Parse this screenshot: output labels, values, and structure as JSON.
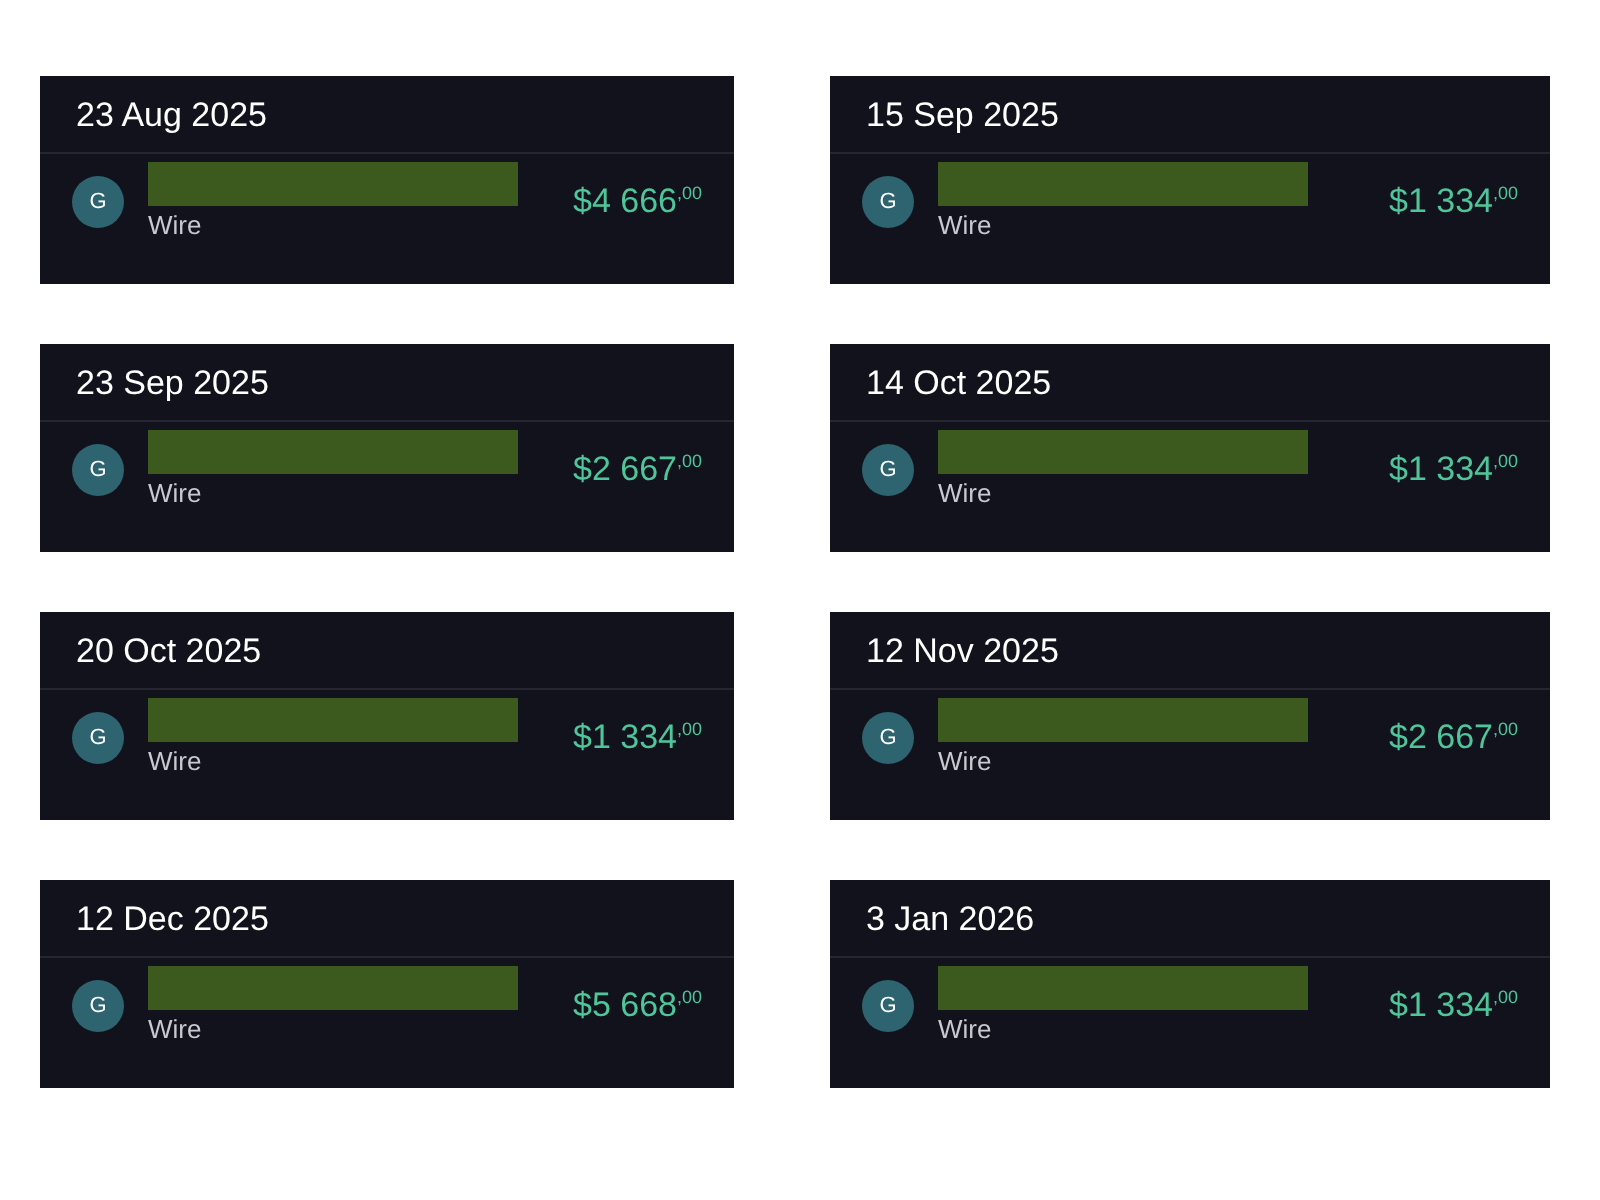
{
  "transactions": [
    {
      "date": "23 Aug 2025",
      "avatar": "G",
      "method": "Wire",
      "amount": "$4 666$^{,00}$"
    },
    {
      "date": "15 Sep 2025",
      "avatar": "G",
      "method": "Wire",
      "amount": "$1 334$^{,00}$"
    },
    {
      "date": "23 Sep 2025",
      "avatar": "G",
      "method": "Wire",
      "amount": "$2 667$^{,00}$"
    },
    {
      "date": "14 Oct 2025",
      "avatar": "G",
      "method": "Wire",
      "amount": "$1 334$^{,00}$"
    },
    {
      "date": "20 Oct 2025",
      "avatar": "G",
      "method": "Wire",
      "amount": "$1 334$^{,00}$"
    },
    {
      "date": "12 Nov 2025",
      "avatar": "G",
      "method": "Wire",
      "amount": "$2 667$^{,00}$"
    },
    {
      "date": "12 Dec 2025",
      "avatar": "G",
      "method": "Wire",
      "amount": "$5 668$^{,00}$"
    },
    {
      "date": "3 Jan 2026",
      "avatar": "G",
      "method": "Wire",
      "amount": "$1 334$^{,00}$"
    }
  ]
}
